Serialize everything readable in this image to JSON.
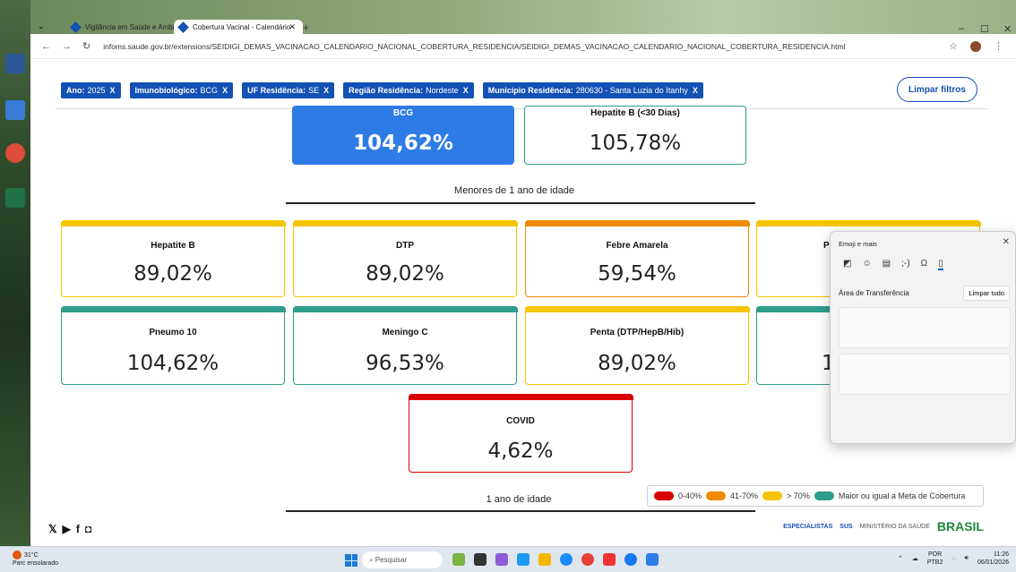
{
  "browser": {
    "tabs": [
      {
        "label": "Vigilância em Saúde e Ambiente",
        "active": false
      },
      {
        "label": "Cobertura Vacinal - Calendário",
        "active": true
      }
    ],
    "url": "infoms.saude.gov.br/extensions/SEIDIGI_DEMAS_VACINACAO_CALENDARIO_NACIONAL_COBERTURA_RESIDENCIA/SEIDIGI_DEMAS_VACINACAO_CALENDARIO_NACIONAL_COBERTURA_RESIDENCIA.html"
  },
  "filters": [
    {
      "label": "Ano:",
      "value": "2025"
    },
    {
      "label": "Imunobiológico:",
      "value": "BCG"
    },
    {
      "label": "UF Residência:",
      "value": "SE"
    },
    {
      "label": "Região Residência:",
      "value": "Nordeste"
    },
    {
      "label": "Município Residência:",
      "value": "280630 - Santa Luzia do Itanhy"
    }
  ],
  "clear_filters_label": "Limpar filtros",
  "top_cards": [
    {
      "name": "BCG",
      "value": "104,62%"
    },
    {
      "name": "Hepatite B (<30 Dias)",
      "value": "105,78%"
    }
  ],
  "section_under1": "Menores de 1 ano de idade",
  "row1": [
    {
      "name": "Hepatite B",
      "value": "89,02%",
      "color": "#f5c400"
    },
    {
      "name": "DTP",
      "value": "89,02%",
      "color": "#f5c400"
    },
    {
      "name": "Febre Amarela",
      "value": "59,54%",
      "color": "#f08a00"
    },
    {
      "name": "P",
      "value": "",
      "color": "#f5c400"
    }
  ],
  "row2": [
    {
      "name": "Pneumo 10",
      "value": "104,62%",
      "color": "#2e9e8a"
    },
    {
      "name": "Meningo C",
      "value": "96,53%",
      "color": "#2e9e8a"
    },
    {
      "name": "Penta (DTP/HepB/Hib)",
      "value": "89,02%",
      "color": "#f5c400"
    },
    {
      "name": "",
      "value": "1",
      "color": "#2e9e8a"
    }
  ],
  "covid_card": {
    "name": "COVID",
    "value": "4,62%",
    "color": "#d90000"
  },
  "section_1year": "1 ano de idade",
  "legend": [
    {
      "label": "0-40%",
      "color": "#d90000"
    },
    {
      "label": "41-70%",
      "color": "#f08a00"
    },
    {
      "label": "> 70%",
      "color": "#f5c400"
    },
    {
      "label": "Maior ou igual a Meta de Cobertura",
      "color": "#2e9e8a"
    }
  ],
  "footer": {
    "logos": [
      "ESPECIALISTAS",
      "SUS",
      "MINISTÉRIO DA SAÚDE",
      "BRASIL"
    ]
  },
  "emoji_panel": {
    "title": "Emoji e mais",
    "section": "Área de Transferência",
    "clear_label": "Limpar tudo"
  },
  "taskbar": {
    "temperature": "31°C",
    "weather": "Parc ensolarado",
    "search_placeholder": "Pesquisar",
    "lang": "POR",
    "layout": "PTB2",
    "time": "11:26",
    "date": "06/01/2026"
  }
}
